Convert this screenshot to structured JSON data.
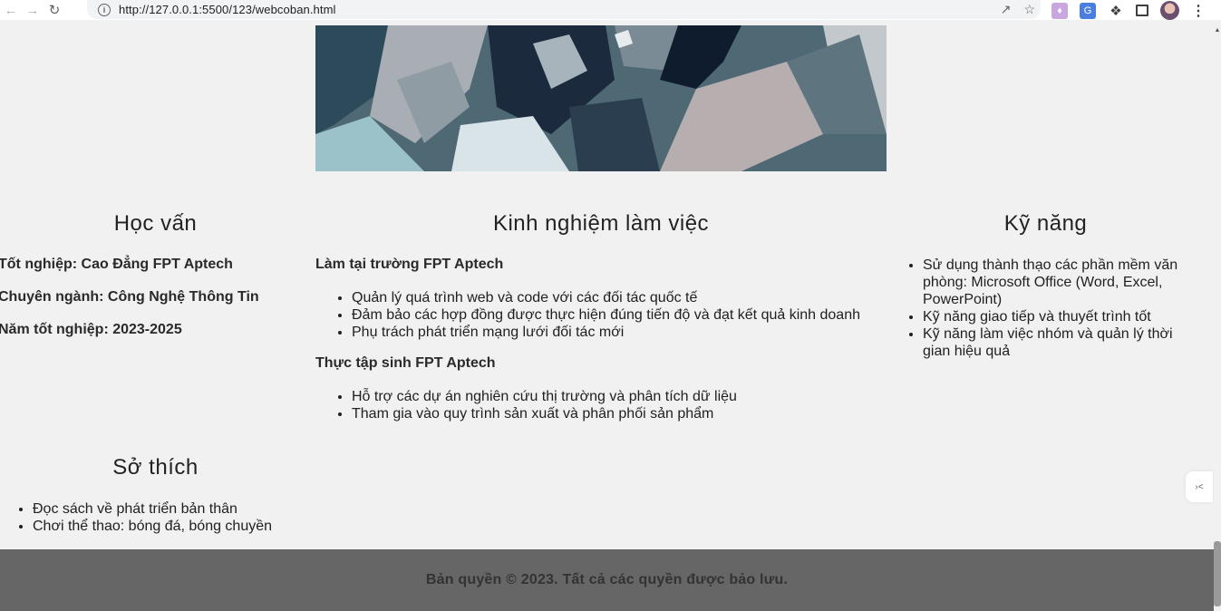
{
  "browser": {
    "url": "http://127.0.0.1:5500/123/webcoban.html",
    "back_icon": "arrow-left-icon",
    "forward_icon": "arrow-right-icon",
    "reload_icon": "reload-icon"
  },
  "education": {
    "title": "Học vấn",
    "lines": [
      "Tốt nghiệp: Cao Đẳng FPT Aptech",
      "Chuyên ngành: Công Nghệ Thông Tin",
      "Năm tốt nghiệp: 2023-2025"
    ]
  },
  "experience": {
    "title": "Kinh nghiệm làm việc",
    "jobs": [
      {
        "role": "Làm tại trường FPT Aptech",
        "items": [
          "Quản lý quá trình web và code với các đối tác quốc tế",
          "Đảm bảo các hợp đồng được thực hiện đúng tiến độ và đạt kết quả kinh doanh",
          "Phụ trách phát triển mạng lưới đối tác mới"
        ]
      },
      {
        "role": "Thực tập sinh FPT Aptech",
        "items": [
          "Hỗ trợ các dự án nghiên cứu thị trường và phân tích dữ liệu",
          "Tham gia vào quy trình sản xuất và phân phối sản phẩm"
        ]
      }
    ]
  },
  "skills": {
    "title": "Kỹ năng",
    "items": [
      "Sử dụng thành thạo các phần mềm văn phòng: Microsoft Office (Word, Excel, PowerPoint)",
      "Kỹ năng giao tiếp và thuyết trình tốt",
      "Kỹ năng làm việc nhóm và quản lý thời gian hiệu quả"
    ]
  },
  "hobbies": {
    "title": "Sở thích",
    "items": [
      "Đọc sách về phát triển bản thân",
      "Chơi thể thao: bóng đá, bóng chuyền"
    ]
  },
  "footer": {
    "text": "Bản quyền © 2023. Tất cả các quyền được bảo lưu."
  }
}
